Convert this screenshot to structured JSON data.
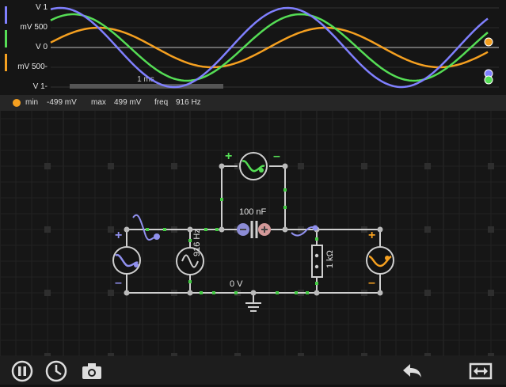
{
  "scope": {
    "y_labels": [
      "1 V",
      "500 mV",
      "0 V",
      "-500 mV",
      "-1 V"
    ],
    "time_label": "1 ms",
    "trace_colors": [
      "#8080ff",
      "#55dd55",
      "#f5a020"
    ],
    "trace_names": [
      "input-trace",
      "capacitor-trace",
      "output-trace"
    ]
  },
  "info": {
    "dot_color": "#f5a020",
    "min_label": "min",
    "min_value": "-499 mV",
    "max_label": "max",
    "max_value": "499 mV",
    "freq_label": "freq",
    "freq_value": "916 Hz"
  },
  "circuit": {
    "capacitor_label": "100 nF",
    "source_label": "916 Hz",
    "resistor_label": "1 kΩ",
    "ground_label": "0 V",
    "plus": "+",
    "minus": "–"
  },
  "toolbar": {
    "icons": [
      "pause-icon",
      "clock-icon",
      "camera-icon",
      "undo-icon",
      "fit-icon"
    ]
  }
}
